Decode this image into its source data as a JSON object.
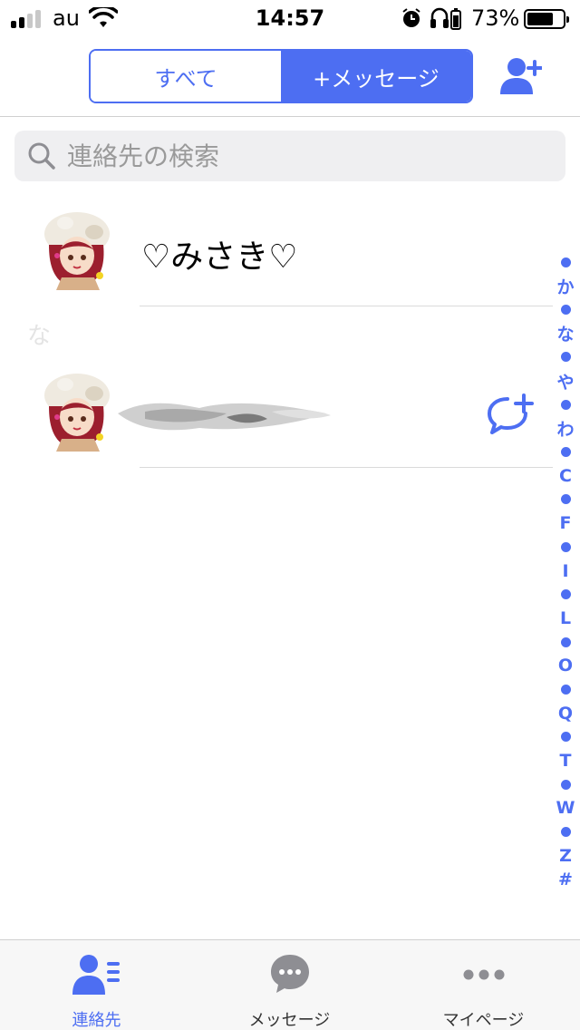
{
  "status_bar": {
    "carrier": "au",
    "time": "14:57",
    "battery_percent": "73%",
    "battery_level": 0.73,
    "icons": [
      "signal-icon",
      "wifi-icon",
      "alarm-icon",
      "headphones-icon",
      "battery-icon"
    ]
  },
  "header": {
    "tab_all": "すべて",
    "tab_message": "+メッセージ",
    "active_tab": "tab_message",
    "add_contact_icon": "add-contact-icon"
  },
  "search": {
    "placeholder": "連絡先の検索",
    "value": ""
  },
  "contacts": [
    {
      "name": "♡みさき♡",
      "avatar": "avatar-chef-girl"
    },
    {
      "name": "",
      "avatar": "avatar-chef-girl",
      "name_obscured": true,
      "action_icon": "chat-add-icon"
    }
  ],
  "section_label": "な",
  "index_bar": [
    "•",
    "か",
    "•",
    "な",
    "•",
    "や",
    "•",
    "わ",
    "•",
    "C",
    "•",
    "F",
    "•",
    "I",
    "•",
    "L",
    "•",
    "O",
    "•",
    "Q",
    "•",
    "T",
    "•",
    "W",
    "•",
    "Z",
    "#"
  ],
  "tabbar": {
    "items": [
      {
        "label": "連絡先",
        "icon": "contacts-icon",
        "active": true
      },
      {
        "label": "メッセージ",
        "icon": "message-icon",
        "active": false
      },
      {
        "label": "マイページ",
        "icon": "more-icon",
        "active": false
      }
    ]
  },
  "colors": {
    "accent": "#4d6ef2",
    "gray_icon": "#8e8e93",
    "search_bg": "#efeff1"
  }
}
